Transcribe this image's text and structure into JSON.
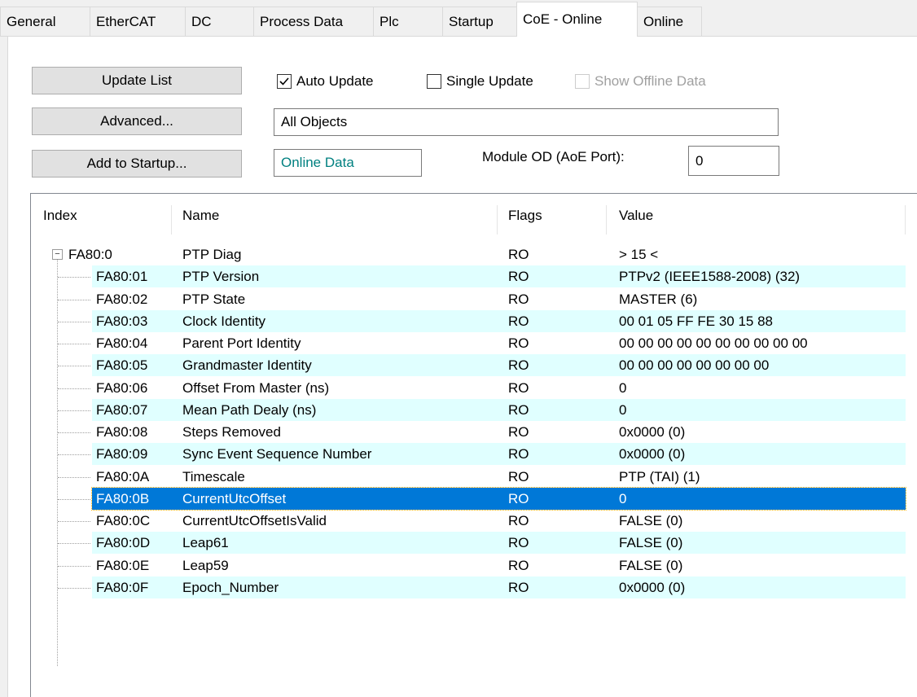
{
  "tabs": [
    {
      "label": "General"
    },
    {
      "label": "EtherCAT"
    },
    {
      "label": "DC"
    },
    {
      "label": "Process Data"
    },
    {
      "label": "Plc"
    },
    {
      "label": "Startup"
    },
    {
      "label": "CoE - Online"
    },
    {
      "label": "Online"
    }
  ],
  "active_tab": "CoE - Online",
  "buttons": {
    "update_list": "Update List",
    "advanced": "Advanced...",
    "add_to_startup": "Add to Startup..."
  },
  "checkboxes": {
    "auto_update": {
      "label": "Auto Update",
      "checked": true
    },
    "single_update": {
      "label": "Single Update",
      "checked": false
    },
    "show_offline": {
      "label": "Show Offline Data",
      "checked": false,
      "disabled": true
    }
  },
  "fields": {
    "filter_value": "All Objects",
    "data_mode": "Online Data",
    "module_od_label": "Module OD (AoE Port):",
    "module_od_value": "0"
  },
  "columns": {
    "index": "Index",
    "name": "Name",
    "flags": "Flags",
    "value": "Value"
  },
  "rows": [
    {
      "index": "FA80:0",
      "name": "PTP Diag",
      "flags": "RO",
      "value": "> 15 <"
    },
    {
      "index": "FA80:01",
      "name": "PTP Version",
      "flags": "RO",
      "value": "PTPv2 (IEEE1588-2008) (32)"
    },
    {
      "index": "FA80:02",
      "name": "PTP State",
      "flags": "RO",
      "value": "MASTER (6)"
    },
    {
      "index": "FA80:03",
      "name": "Clock Identity",
      "flags": "RO",
      "value": "00 01 05 FF FE 30 15 88"
    },
    {
      "index": "FA80:04",
      "name": "Parent Port Identity",
      "flags": "RO",
      "value": "00 00 00 00 00 00 00 00 00 00"
    },
    {
      "index": "FA80:05",
      "name": "Grandmaster Identity",
      "flags": "RO",
      "value": "00 00 00 00 00 00 00 00"
    },
    {
      "index": "FA80:06",
      "name": "Offset From Master (ns)",
      "flags": "RO",
      "value": "0"
    },
    {
      "index": "FA80:07",
      "name": "Mean Path Dealy (ns)",
      "flags": "RO",
      "value": "0"
    },
    {
      "index": "FA80:08",
      "name": "Steps Removed",
      "flags": "RO",
      "value": "0x0000 (0)"
    },
    {
      "index": "FA80:09",
      "name": "Sync Event Sequence Number",
      "flags": "RO",
      "value": "0x0000 (0)"
    },
    {
      "index": "FA80:0A",
      "name": "Timescale",
      "flags": "RO",
      "value": "PTP (TAI) (1)"
    },
    {
      "index": "FA80:0B",
      "name": "CurrentUtcOffset",
      "flags": "RO",
      "value": "0"
    },
    {
      "index": "FA80:0C",
      "name": "CurrentUtcOffsetIsValid",
      "flags": "RO",
      "value": "FALSE (0)"
    },
    {
      "index": "FA80:0D",
      "name": "Leap61",
      "flags": "RO",
      "value": "FALSE (0)"
    },
    {
      "index": "FA80:0E",
      "name": "Leap59",
      "flags": "RO",
      "value": "FALSE (0)"
    },
    {
      "index": "FA80:0F",
      "name": "Epoch_Number",
      "flags": "RO",
      "value": "0x0000 (0)"
    }
  ],
  "selected_index": "FA80:0B",
  "colors": {
    "selection": "#0078d7",
    "stripe": "#e0ffff",
    "data_mode_text": "#008080"
  }
}
